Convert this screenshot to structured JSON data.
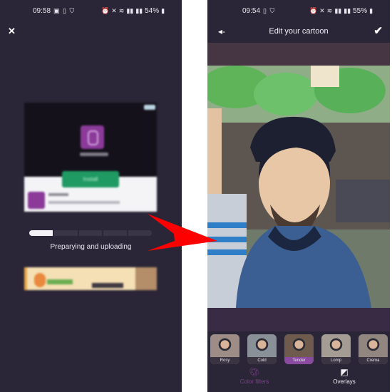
{
  "left_screen": {
    "status": {
      "time": "09:58",
      "battery": "54%",
      "left_icons": [
        "image-icon",
        "sim-icon",
        "shield-icon"
      ],
      "right_icons": [
        "alarm-icon",
        "mute-icon",
        "wifi-icon",
        "volte-signal-icon",
        "volte-signal-icon"
      ]
    },
    "close_label": "✕",
    "ad": {
      "install_label": "Install"
    },
    "progress": {
      "segments": 5,
      "completed_segments": 1,
      "label": "Preparying and uploading"
    }
  },
  "right_screen": {
    "status": {
      "time": "09:54",
      "battery": "55%",
      "left_icons": [
        "sim-icon",
        "shield-icon"
      ],
      "right_icons": [
        "alarm-icon",
        "mute-icon",
        "wifi-icon",
        "volte-signal-icon",
        "volte-signal-icon"
      ]
    },
    "title": "Edit your cartoon",
    "back_icon": "◂-",
    "confirm_icon": "✔",
    "filters": [
      {
        "label": "Rosy",
        "selected": false
      },
      {
        "label": "Cold",
        "selected": false
      },
      {
        "label": "Tender",
        "selected": true
      },
      {
        "label": "Lomp",
        "selected": false
      },
      {
        "label": "Crema",
        "selected": false
      }
    ],
    "tabs": [
      {
        "label": "Color filters",
        "icon": "palette-icon",
        "active": true
      },
      {
        "label": "Overlays",
        "icon": "layers-icon",
        "active": false
      }
    ]
  },
  "colors": {
    "background": "#2b2637",
    "accent": "#8a4aa0",
    "arrow": "#ff0000"
  }
}
